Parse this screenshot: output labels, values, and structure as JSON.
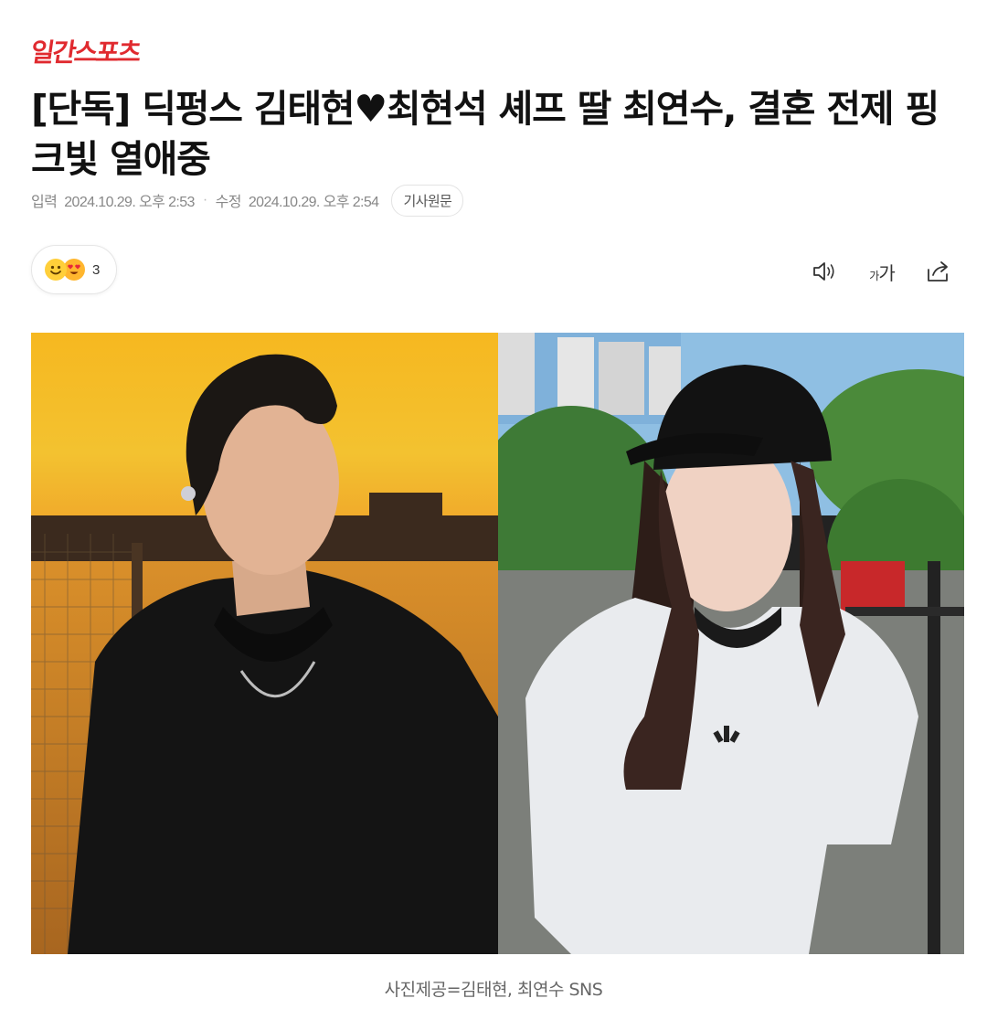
{
  "brand": {
    "name": "일간스포츠"
  },
  "article": {
    "headline": "[단독] 딕펑스 김태현♥최현석 셰프 딸 최연수, 결혼 전제 핑크빛 열애중",
    "input_label": "입력",
    "input_time": "2024.10.29. 오후 2:53",
    "modified_label": "수정",
    "modified_time": "2024.10.29. 오후 2:54",
    "original_link_label": "기사원문",
    "reaction_count": "3",
    "font_size_label_small": "가",
    "font_size_label_large": "가",
    "photo_caption": "사진제공=김태현, 최연수 SNS"
  },
  "icons": {
    "reaction_1": "smiling-face-icon",
    "reaction_2": "heart-eyes-face-icon",
    "tool_1": "speaker-icon",
    "tool_2": "font-size-icon",
    "tool_3": "share-icon"
  },
  "colors": {
    "brand": "#e02a2f",
    "headline": "#111111",
    "meta": "#888888",
    "caption": "#666666"
  }
}
